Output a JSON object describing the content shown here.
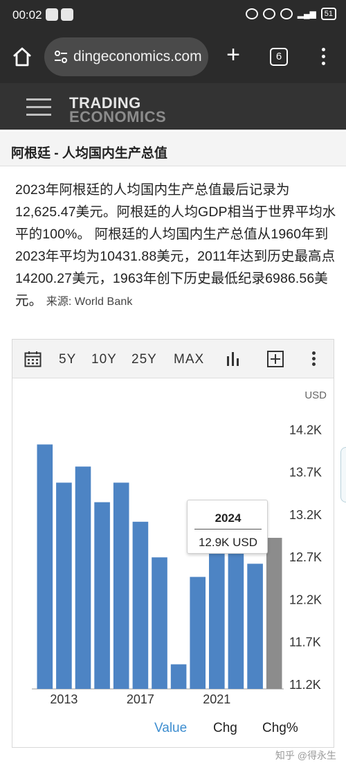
{
  "status_bar": {
    "time": "00:02",
    "battery": "51"
  },
  "browser": {
    "url": "dingeconomics.com",
    "tab_count": "6"
  },
  "site": {
    "logo_line1": "TRADING",
    "logo_line2": "ECONOMICS"
  },
  "page": {
    "title": "阿根廷 - 人均国内生产总值",
    "description": "2023年阿根廷的人均国内生产总值最后记录为12,625.47美元。阿根廷的人均GDP相当于世界平均水平的100%。 阿根廷的人均国内生产总值从1960年到2023年平均为10431.88美元，2011年达到历史最高点14200.27美元，1963年创下历史最低纪录6986.56美元。",
    "source": "来源: World Bank"
  },
  "toolbar": {
    "ranges": [
      "5Y",
      "10Y",
      "25Y",
      "MAX"
    ]
  },
  "chart": {
    "unit": "USD",
    "tooltip": {
      "year": "2024",
      "value": "12.9K USD"
    },
    "view_tabs": [
      "Value",
      "Chg",
      "Chg%"
    ],
    "active_tab": "Value"
  },
  "chart_data": {
    "type": "bar",
    "categories": [
      "2012",
      "2013",
      "2014",
      "2015",
      "2016",
      "2017",
      "2018",
      "2019",
      "2020",
      "2021",
      "2022",
      "2023",
      "2024"
    ],
    "values": [
      14030,
      13580,
      13770,
      13350,
      13580,
      13120,
      12700,
      11440,
      12470,
      12910,
      12790,
      12625,
      12930
    ],
    "highlighted_category": "2024",
    "ylim": [
      11150,
      14400
    ],
    "yticks": [
      11200,
      11700,
      12200,
      12700,
      13200,
      13700,
      14200
    ],
    "ytick_labels": [
      "11.2K",
      "11.7K",
      "12.2K",
      "12.7K",
      "13.2K",
      "13.7K",
      "14.2K"
    ],
    "xtick_labels": [
      "2013",
      "2017",
      "2021"
    ],
    "y_axis_position": "right",
    "colors": {
      "bar": "#4d84c4",
      "highlight_bar": "#8c8c8c"
    }
  },
  "watermark": "知乎 @得永生"
}
